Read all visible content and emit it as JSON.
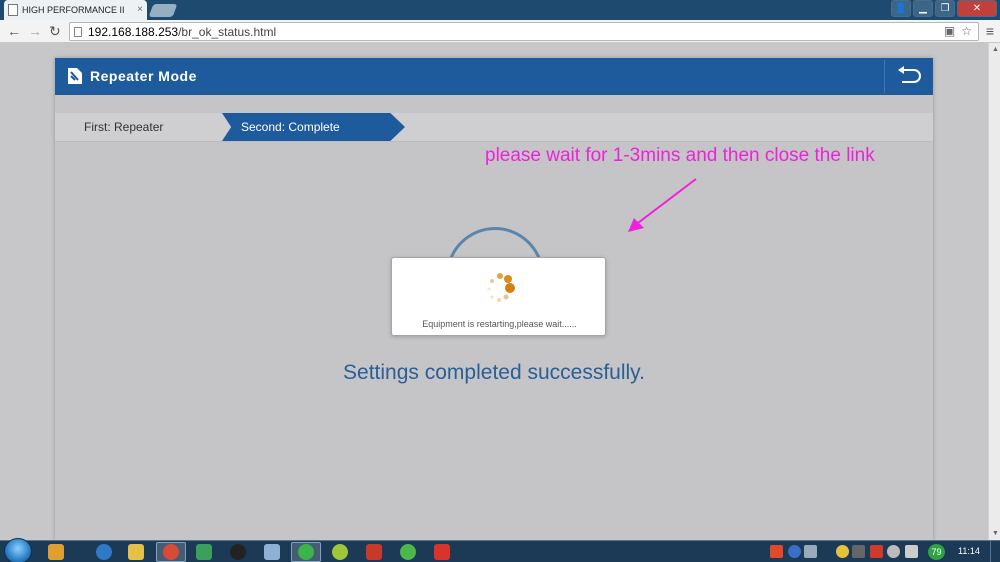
{
  "browser": {
    "tab_title": "HIGH PERFORMANCE II",
    "tab_close": "×",
    "url_host": "192.168.188.253",
    "url_path": "/br_ok_status.html",
    "back_glyph": "←",
    "forward_glyph": "→",
    "reload_glyph": "↻",
    "star_glyph": "☆",
    "translate_glyph": "▣",
    "menu_glyph": "≡",
    "minimize_glyph": "▁",
    "restore_glyph": "❐",
    "close_glyph": "✕",
    "user_glyph": "👤"
  },
  "panel": {
    "title": "Repeater Mode",
    "header_color": "#1e5b9c"
  },
  "steps": [
    {
      "label": "First: Repeater",
      "active": false
    },
    {
      "label": "Second: Complete",
      "active": true
    }
  ],
  "main": {
    "success_message": "Settings completed successfully."
  },
  "dialog": {
    "message": "Equipment is restarting,please wait......"
  },
  "annotation": {
    "text": "please wait for 1-3mins and then close the link",
    "color": "#ee22dd"
  },
  "taskbar": {
    "clock": "11:14",
    "badge": "79"
  },
  "icons": {
    "panel_mode": "repeater-icon",
    "back": "return-arrow-icon",
    "spinner": "loading-spinner-icon"
  }
}
